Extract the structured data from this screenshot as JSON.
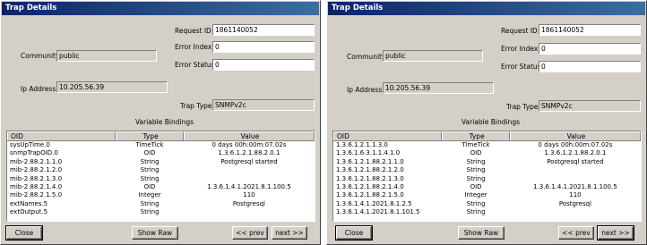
{
  "windows": [
    {
      "title": "Trap Details",
      "request_id_label": "Request ID",
      "request_id": "1861140052",
      "error_index_label": "Error Index",
      "error_index": "0",
      "error_status_label": "Error Status",
      "error_status": "0",
      "community_label": "Community",
      "community": "public",
      "ip_address_label": "Ip Address",
      "ip_address": "10.205.56.39",
      "trap_type_label": "Trap Type",
      "trap_type": "SNMPv2c",
      "bindings_title": "Variable Bindings",
      "columns": [
        "OID",
        "Type",
        "Value"
      ],
      "rows": [
        [
          "sysUpTime.0",
          "TimeTick",
          "0 days 00h:00m:07.02s"
        ],
        [
          "snmpTrapOID.0",
          "OID",
          "1.3.6.1.2.1.88.2.0.1"
        ],
        [
          "mib-2.88.2.1.1.0",
          "String",
          "Postgresql started"
        ],
        [
          "mib-2.88.2.1.2.0",
          "String",
          ""
        ],
        [
          "mib-2.88.2.1.3.0",
          "String",
          ""
        ],
        [
          "mib-2.88.2.1.4.0",
          "OID",
          "1.3.6.1.4.1.2021.8.1.100.5"
        ],
        [
          "mib-2.88.2.1.5.0",
          "Integer",
          "110"
        ],
        [
          "extNames.5",
          "String",
          "Postgresql"
        ],
        [
          "extOutput.5",
          "String",
          ""
        ]
      ],
      "close_label": "Close",
      "show_raw_label": "Show Raw",
      "prev_label": "<< prev",
      "next_label": "next >>"
    },
    {
      "title": "Trap Details",
      "request_id_label": "Request ID",
      "request_id": "1861140052",
      "error_index_label": "Error Index",
      "error_index": "0",
      "error_status_label": "Error Status",
      "error_status": "0",
      "community_label": "Community",
      "community": "public",
      "ip_address_label": "Ip Address",
      "ip_address": "10.205.56.39",
      "trap_type_label": "Trap Type",
      "trap_type": "SNMPv2c",
      "bindings_title": "Variable Bindings",
      "columns": [
        "OID",
        "Type",
        "Value"
      ],
      "rows": [
        [
          "1.3.6.1.2.1.1.3.0",
          "TimeTick",
          "0 days 00h:00m:07.02s"
        ],
        [
          "1.3.6.1.6.3.1.1.4.1.0",
          "OID",
          "1.3.6.1.2.1.88.2.0.1"
        ],
        [
          "1.3.6.1.2.1.88.2.1.1.0",
          "String",
          "Postgresql started"
        ],
        [
          "1.3.6.1.2.1.88.2.1.2.0",
          "String",
          ""
        ],
        [
          "1.3.6.1.2.1.88.2.1.3.0",
          "String",
          ""
        ],
        [
          "1.3.6.1.2.1.88.2.1.4.0",
          "OID",
          "1.3.6.1.4.1.2021.8.1.100.5"
        ],
        [
          "1.3.6.1.2.1.88.2.1.5.0",
          "Integer",
          "110"
        ],
        [
          "1.3.6.1.4.1.2021.8.1.2.5",
          "String",
          "Postgresql"
        ],
        [
          "1.3.6.1.4.1.2021.8.1.101.5",
          "String",
          ""
        ]
      ],
      "close_label": "Close",
      "show_raw_label": "Show Raw",
      "prev_label": "<< prev",
      "next_label": "next >>"
    }
  ]
}
